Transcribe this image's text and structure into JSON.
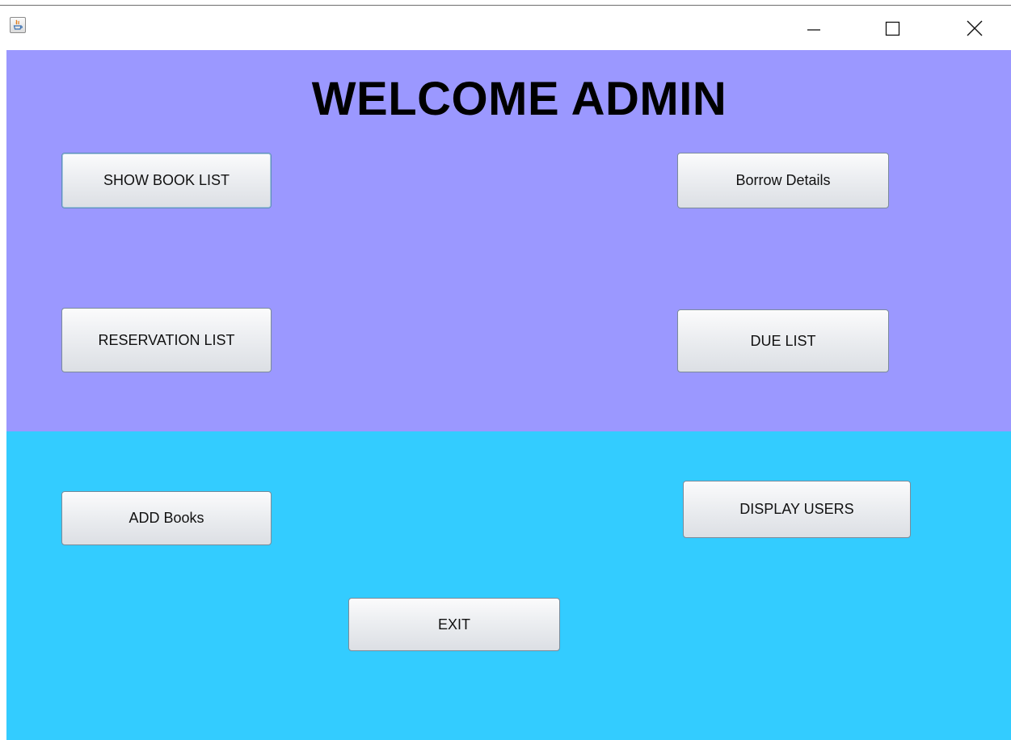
{
  "window": {
    "controls": {
      "minimize_icon": "minimize-icon",
      "maximize_icon": "maximize-icon",
      "close_icon": "close-icon"
    }
  },
  "colors": {
    "top_panel": "#9b98ff",
    "bottom_panel": "#33ccff"
  },
  "heading": "WELCOME ADMIN",
  "buttons": {
    "show_book_list": "SHOW BOOK LIST",
    "borrow_details": "Borrow Details",
    "reservation_list": "RESERVATION LIST",
    "due_list": "DUE LIST",
    "add_books": "ADD Books",
    "display_users": "DISPLAY USERS",
    "exit": "EXIT"
  }
}
